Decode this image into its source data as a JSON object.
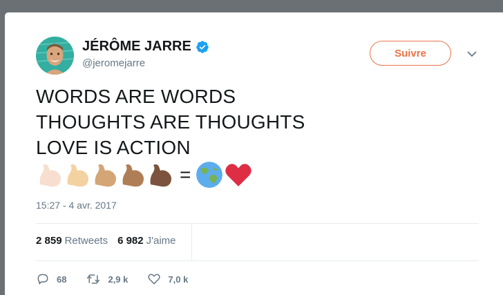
{
  "author": {
    "name": "JÉRÔME JARRE",
    "handle": "@jeromejarre",
    "verified": true
  },
  "follow_button": {
    "label": "Suivre",
    "color": "#e8744a"
  },
  "tweet": {
    "lines": [
      "WORDS ARE WORDS",
      "THOUGHTS ARE THOUGHTS",
      "LOVE IS ACTION"
    ],
    "emoji": [
      "flexed-biceps-light-skin",
      "flexed-biceps-medium-light-skin",
      "flexed-biceps-medium-skin",
      "flexed-biceps-medium-dark-skin",
      "flexed-biceps-dark-skin",
      "equals",
      "globe-asia-australia",
      "red-heart"
    ],
    "equals": "=",
    "timestamp": "15:27 - 4 avr. 2017"
  },
  "stats": {
    "retweets_count": "2 859",
    "retweets_label": "Retweets",
    "likes_count": "6 982",
    "likes_label": "J'aime"
  },
  "actions": {
    "reply_count": "68",
    "retweet_count": "2,9 k",
    "like_count": "7,0 k"
  },
  "colors": {
    "text": "#14171a",
    "muted": "#657786",
    "verified": "#1da1f2"
  }
}
